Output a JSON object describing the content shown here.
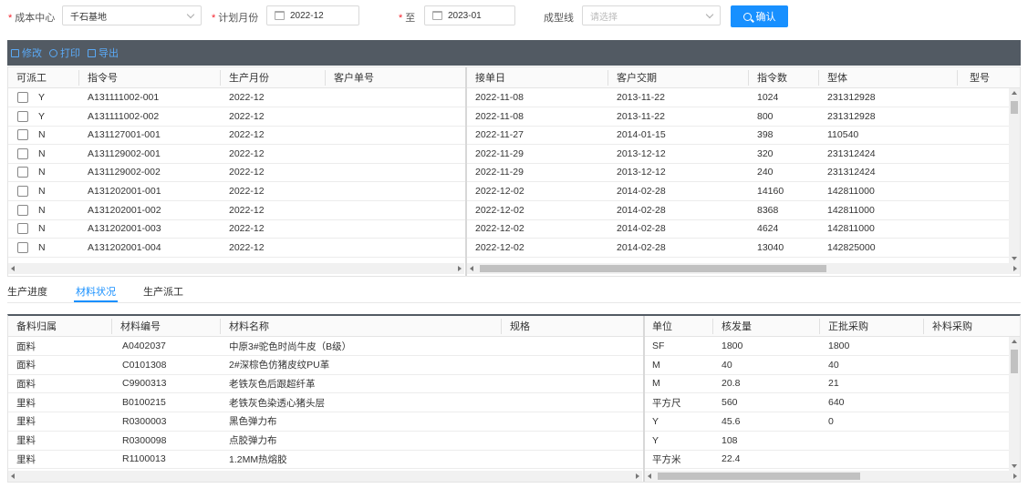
{
  "filters": {
    "cost_center_label": "成本中心",
    "cost_center_value": "千石基地",
    "plan_month_label": "计划月份",
    "plan_month_start": "2022-12",
    "to_label": "至",
    "plan_month_end": "2023-01",
    "forming_line_label": "成型线",
    "forming_line_placeholder": "请选择",
    "confirm_label": "确认"
  },
  "toolbar": {
    "edit_label": "修改",
    "print_label": "打印",
    "export_label": "导出"
  },
  "orders": {
    "columns": [
      "可派工",
      "指令号",
      "生产月份",
      "客户单号",
      "接单日",
      "客户交期",
      "指令数",
      "型体",
      "型号"
    ],
    "rows": [
      [
        "Y",
        "A131111002-001",
        "2022-12",
        "",
        "2022-11-08",
        "2013-11-22",
        "1024",
        "231312928",
        ""
      ],
      [
        "Y",
        "A131111002-002",
        "2022-12",
        "",
        "2022-11-08",
        "2013-11-22",
        "800",
        "231312928",
        ""
      ],
      [
        "N",
        "A131127001-001",
        "2022-12",
        "",
        "2022-11-27",
        "2014-01-15",
        "398",
        "110540",
        ""
      ],
      [
        "N",
        "A131129002-001",
        "2022-12",
        "",
        "2022-11-29",
        "2013-12-12",
        "320",
        "231312424",
        ""
      ],
      [
        "N",
        "A131129002-002",
        "2022-12",
        "",
        "2022-11-29",
        "2013-12-12",
        "240",
        "231312424",
        ""
      ],
      [
        "N",
        "A131202001-001",
        "2022-12",
        "",
        "2022-12-02",
        "2014-02-28",
        "14160",
        "142811000",
        ""
      ],
      [
        "N",
        "A131202001-002",
        "2022-12",
        "",
        "2022-12-02",
        "2014-02-28",
        "8368",
        "142811000",
        ""
      ],
      [
        "N",
        "A131202001-003",
        "2022-12",
        "",
        "2022-12-02",
        "2014-02-28",
        "4624",
        "142811000",
        ""
      ],
      [
        "N",
        "A131202001-004",
        "2022-12",
        "",
        "2022-12-02",
        "2014-02-28",
        "13040",
        "142825000",
        ""
      ]
    ]
  },
  "tabs": [
    {
      "label": "生产进度"
    },
    {
      "label": "材料状况"
    },
    {
      "label": "生产派工"
    }
  ],
  "materials": {
    "columns": [
      "备料归属",
      "材料编号",
      "材料名称",
      "规格",
      "单位",
      "核发量",
      "正批采购",
      "补料采购"
    ],
    "rows": [
      [
        "面料",
        "A0402037",
        "中原3#驼色时尚牛皮（B级）",
        "",
        "SF",
        "1800",
        "1800",
        ""
      ],
      [
        "面料",
        "C0101308",
        "2#深棕色仿猪皮纹PU革",
        "",
        "M",
        "40",
        "40",
        ""
      ],
      [
        "面料",
        "C9900313",
        "老铁灰色后跟超纤革",
        "",
        "M",
        "20.8",
        "21",
        ""
      ],
      [
        "里料",
        "B0100215",
        "老铁灰色染透心猪头层",
        "",
        "平方尺",
        "560",
        "640",
        ""
      ],
      [
        "里料",
        "R0300003",
        "黑色弹力布",
        "",
        "Y",
        "45.6",
        "0",
        ""
      ],
      [
        "里料",
        "R0300098",
        "点胶弹力布",
        "",
        "Y",
        "108",
        "",
        ""
      ],
      [
        "里料",
        "R1100013",
        "1.2MM热熔胶",
        "",
        "平方米",
        "22.4",
        "",
        ""
      ]
    ]
  }
}
